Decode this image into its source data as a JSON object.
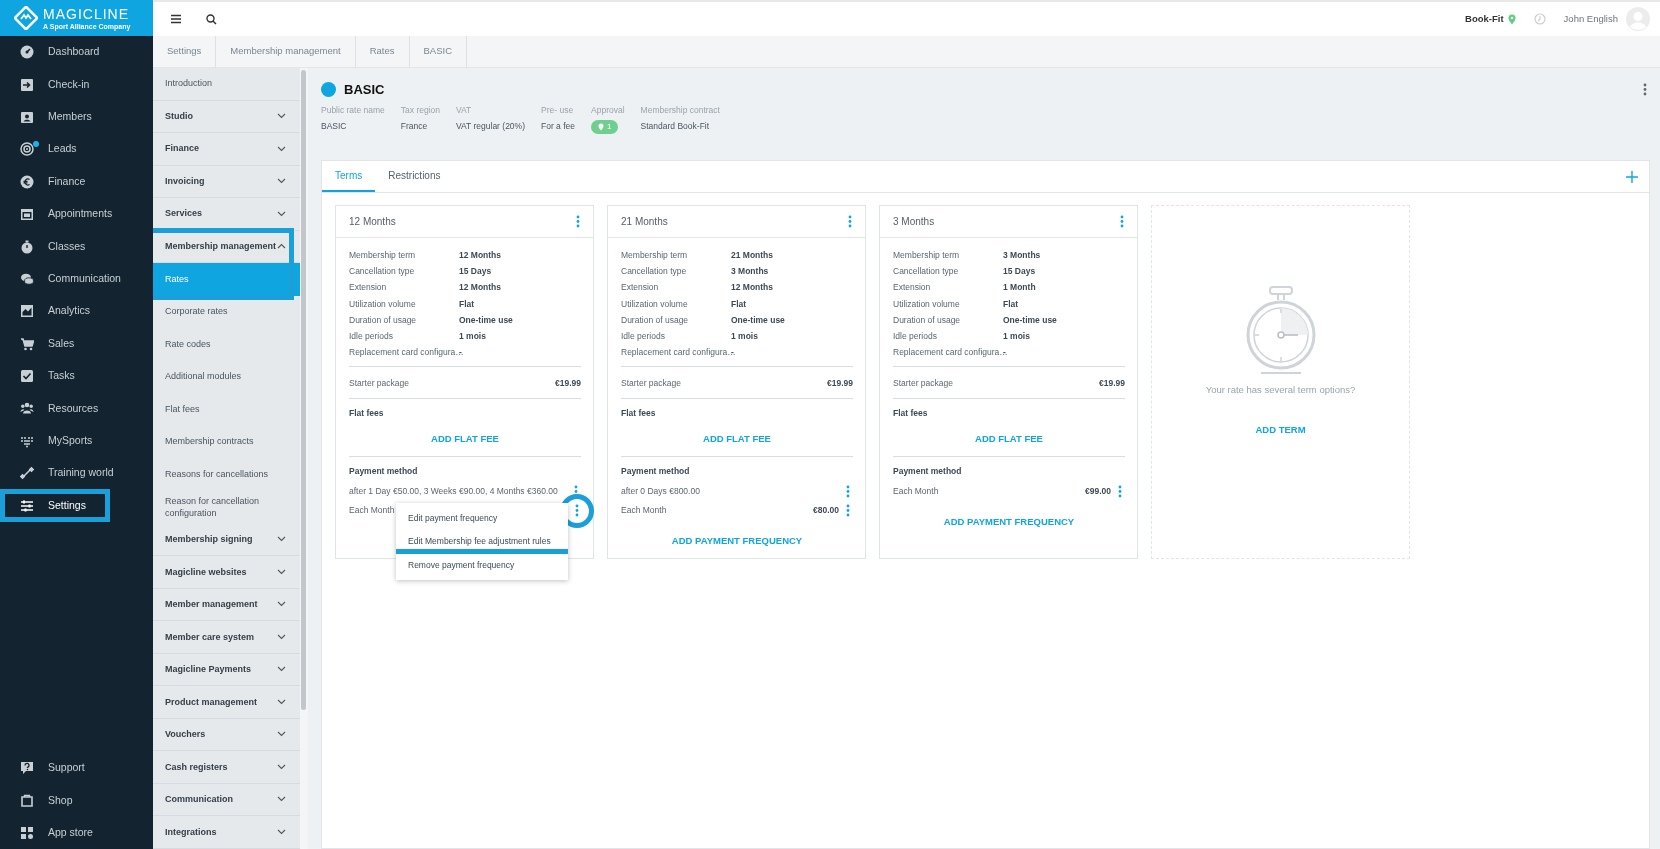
{
  "brand": {
    "name": "MAGICLINE",
    "tagline": "A Sport Alliance Company"
  },
  "nav": {
    "items": [
      {
        "label": "Dashboard",
        "selected": false,
        "notification": false,
        "highlighted": false
      },
      {
        "label": "Check-in",
        "selected": false,
        "notification": false,
        "highlighted": false
      },
      {
        "label": "Members",
        "selected": false,
        "notification": false,
        "highlighted": false
      },
      {
        "label": "Leads",
        "selected": false,
        "notification": true,
        "highlighted": false
      },
      {
        "label": "Finance",
        "selected": false,
        "notification": false,
        "highlighted": false
      },
      {
        "label": "Appointments",
        "selected": false,
        "notification": false,
        "highlighted": false
      },
      {
        "label": "Classes",
        "selected": false,
        "notification": false,
        "highlighted": false
      },
      {
        "label": "Communication",
        "selected": false,
        "notification": false,
        "highlighted": false
      },
      {
        "label": "Analytics",
        "selected": false,
        "notification": false,
        "highlighted": false
      },
      {
        "label": "Sales",
        "selected": false,
        "notification": false,
        "highlighted": false
      },
      {
        "label": "Tasks",
        "selected": false,
        "notification": false,
        "highlighted": false
      },
      {
        "label": "Resources",
        "selected": false,
        "notification": false,
        "highlighted": false
      },
      {
        "label": "MySports",
        "selected": false,
        "notification": false,
        "highlighted": false
      },
      {
        "label": "Training world",
        "selected": false,
        "notification": false,
        "highlighted": false
      },
      {
        "label": "Settings",
        "selected": true,
        "notification": false,
        "highlighted": true
      }
    ],
    "bottom_items": [
      {
        "label": "Support"
      },
      {
        "label": "Shop"
      },
      {
        "label": "App store"
      }
    ]
  },
  "topbar": {
    "studio": "Book-Fit",
    "user": "John English"
  },
  "breadcrumb": [
    "Settings",
    "Membership management",
    "Rates",
    "BASIC"
  ],
  "settings_menu": [
    {
      "kind": "link",
      "label": "Introduction",
      "selected": false
    },
    {
      "kind": "group",
      "label": "Studio",
      "expanded": false,
      "highlighted": false
    },
    {
      "kind": "group",
      "label": "Finance",
      "expanded": false,
      "highlighted": false
    },
    {
      "kind": "group",
      "label": "Invoicing",
      "expanded": false,
      "highlighted": false
    },
    {
      "kind": "group",
      "label": "Services",
      "expanded": false,
      "highlighted": false
    },
    {
      "kind": "group",
      "label": "Membership management",
      "expanded": true,
      "highlighted": true,
      "children": [
        {
          "label": "Rates",
          "selected": true
        },
        {
          "label": "Corporate rates",
          "selected": false
        },
        {
          "label": "Rate codes",
          "selected": false
        },
        {
          "label": "Additional modules",
          "selected": false
        },
        {
          "label": "Flat fees",
          "selected": false
        },
        {
          "label": "Membership contracts",
          "selected": false
        },
        {
          "label": "Reasons for cancellations",
          "selected": false
        },
        {
          "label": "Reason for cancellation configuration",
          "selected": false
        }
      ]
    },
    {
      "kind": "group",
      "label": "Membership signing",
      "expanded": false,
      "highlighted": false
    },
    {
      "kind": "group",
      "label": "Magicline websites",
      "expanded": false,
      "highlighted": false
    },
    {
      "kind": "group",
      "label": "Member management",
      "expanded": false,
      "highlighted": false
    },
    {
      "kind": "group",
      "label": "Member care system",
      "expanded": false,
      "highlighted": false
    },
    {
      "kind": "group",
      "label": "Magicline Payments",
      "expanded": false,
      "highlighted": false
    },
    {
      "kind": "group",
      "label": "Product management",
      "expanded": false,
      "highlighted": false
    },
    {
      "kind": "group",
      "label": "Vouchers",
      "expanded": false,
      "highlighted": false
    },
    {
      "kind": "group",
      "label": "Cash registers",
      "expanded": false,
      "highlighted": false
    },
    {
      "kind": "group",
      "label": "Communication",
      "expanded": false,
      "highlighted": false
    },
    {
      "kind": "group",
      "label": "Integrations",
      "expanded": false,
      "highlighted": false
    }
  ],
  "rate": {
    "name": "BASIC",
    "color": "#0ea5e0",
    "fields": [
      {
        "label": "Public rate name",
        "value": "BASIC",
        "kind": "text"
      },
      {
        "label": "Tax region",
        "value": "France",
        "kind": "text"
      },
      {
        "label": "VAT",
        "value": "VAT regular (20%)",
        "kind": "text"
      },
      {
        "label": "Pre- use",
        "value": "For a fee",
        "kind": "text"
      },
      {
        "label": "Approval",
        "value": "1",
        "kind": "badge"
      },
      {
        "label": "Membership contract",
        "value": "Standard Book-Fit",
        "kind": "text"
      }
    ]
  },
  "tabs": [
    {
      "label": "Terms",
      "selected": true
    },
    {
      "label": "Restrictions",
      "selected": false
    }
  ],
  "terms": [
    {
      "title": "12 Months",
      "details": [
        [
          "Membership term",
          "12 Months"
        ],
        [
          "Cancellation type",
          "15 Days"
        ],
        [
          "Extension",
          "12 Months"
        ],
        [
          "Utilization volume",
          "Flat"
        ],
        [
          "Duration of usage",
          "One-time use"
        ],
        [
          "Idle periods",
          "1 mois"
        ],
        [
          "Replacement card configura…",
          "-"
        ]
      ],
      "starter_label": "Starter package",
      "starter_value": "€19.99",
      "flat_fees_title": "Flat fees",
      "add_flat_fee": "ADD FLAT FEE",
      "payment_title": "Payment method",
      "payments": [
        {
          "label": "after 1 Day €50.00, 3 Weeks €90.00, 4 Months €360.00",
          "highlighted": false
        },
        {
          "label": "Each Month",
          "highlighted": true,
          "menu_open": true
        }
      ],
      "menu": [
        {
          "label": "Edit payment frequency",
          "highlighted": false
        },
        {
          "label": "Edit Membership fee adjustment rules",
          "highlighted": true
        },
        {
          "label": "Remove payment frequency",
          "highlighted": false
        }
      ]
    },
    {
      "title": "21 Months",
      "details": [
        [
          "Membership term",
          "21 Months"
        ],
        [
          "Cancellation type",
          "3 Months"
        ],
        [
          "Extension",
          "12 Months"
        ],
        [
          "Utilization volume",
          "Flat"
        ],
        [
          "Duration of usage",
          "One-time use"
        ],
        [
          "Idle periods",
          "1 mois"
        ],
        [
          "Replacement card configura…",
          "-"
        ]
      ],
      "starter_label": "Starter package",
      "starter_value": "€19.99",
      "flat_fees_title": "Flat fees",
      "add_flat_fee": "ADD FLAT FEE",
      "payment_title": "Payment method",
      "payments": [
        {
          "label": "after 0 Days €800.00",
          "highlighted": false
        },
        {
          "label": "Each Month",
          "amount": "€80.00",
          "highlighted": false
        }
      ],
      "add_payment": "ADD PAYMENT FREQUENCY"
    },
    {
      "title": "3 Months",
      "details": [
        [
          "Membership term",
          "3 Months"
        ],
        [
          "Cancellation type",
          "15 Days"
        ],
        [
          "Extension",
          "1 Month"
        ],
        [
          "Utilization volume",
          "Flat"
        ],
        [
          "Duration of usage",
          "One-time use"
        ],
        [
          "Idle periods",
          "1 mois"
        ],
        [
          "Replacement card configura…",
          "-"
        ]
      ],
      "starter_label": "Starter package",
      "starter_value": "€19.99",
      "flat_fees_title": "Flat fees",
      "add_flat_fee": "ADD FLAT FEE",
      "payment_title": "Payment method",
      "payments": [
        {
          "label": "Each Month",
          "amount": "€99.00",
          "highlighted": false
        }
      ],
      "add_payment": "ADD PAYMENT FREQUENCY"
    }
  ],
  "empty_term": {
    "text": "Your rate has several term options?",
    "action": "ADD TERM"
  }
}
